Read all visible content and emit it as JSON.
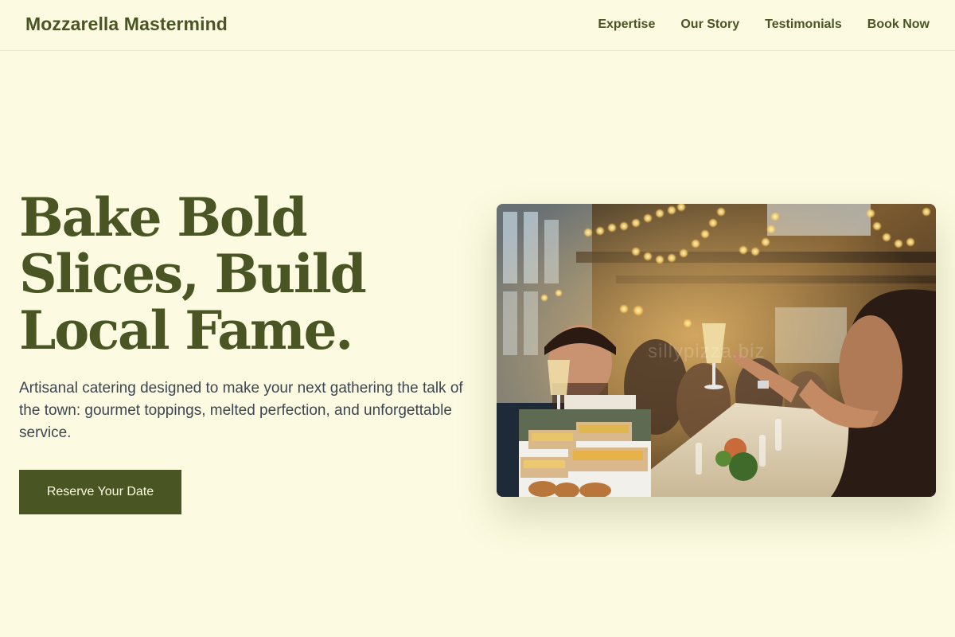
{
  "header": {
    "brand": "Mozzarella Mastermind",
    "nav": [
      {
        "label": "Expertise"
      },
      {
        "label": "Our Story"
      },
      {
        "label": "Testimonials"
      },
      {
        "label": "Book Now"
      }
    ]
  },
  "hero": {
    "title_lines": [
      "Bake Bold",
      "Slices, Build",
      "Local Fame."
    ],
    "subtitle": "Artisanal catering designed to make your next gathering the talk of the town: gourmet toppings, melted perfection, and unforgettable service.",
    "cta_label": "Reserve Your Date",
    "image_watermark": "sillypizza.biz"
  },
  "colors": {
    "background": "#fcfbe1",
    "accent": "#4a5524",
    "body_text": "#3d4554"
  }
}
